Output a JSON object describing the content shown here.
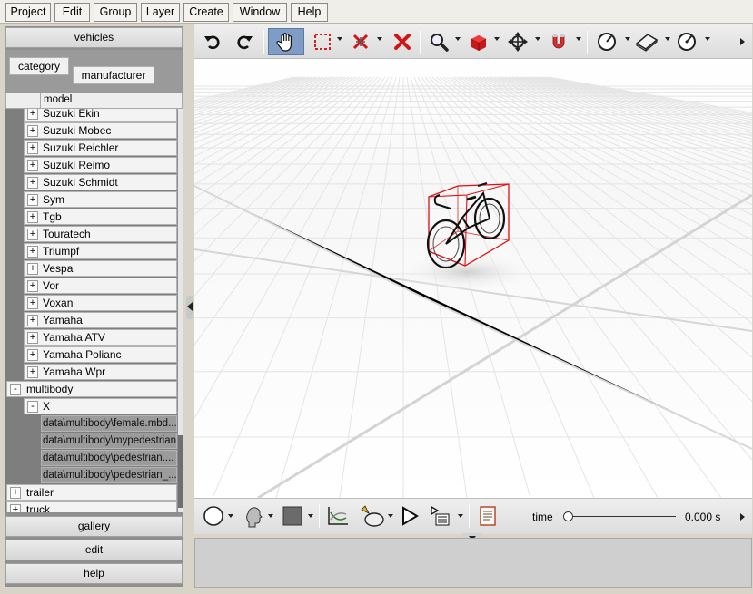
{
  "menu": [
    "Project",
    "Edit",
    "Group",
    "Layer",
    "Create",
    "Window",
    "Help"
  ],
  "sidebar": {
    "header": "vehicles",
    "tabs": [
      "category",
      "manufacturer"
    ],
    "column_header": "model",
    "tree": [
      {
        "label": "Suzuki Ekin",
        "toggle": "+",
        "level": 1
      },
      {
        "label": "Suzuki Mobec",
        "toggle": "+",
        "level": 1
      },
      {
        "label": "Suzuki Reichler",
        "toggle": "+",
        "level": 1
      },
      {
        "label": "Suzuki Reimo",
        "toggle": "+",
        "level": 1
      },
      {
        "label": "Suzuki Schmidt",
        "toggle": "+",
        "level": 1
      },
      {
        "label": "Sym",
        "toggle": "+",
        "level": 1
      },
      {
        "label": "Tgb",
        "toggle": "+",
        "level": 1
      },
      {
        "label": "Touratech",
        "toggle": "+",
        "level": 1
      },
      {
        "label": "Triumpf",
        "toggle": "+",
        "level": 1
      },
      {
        "label": "Vespa",
        "toggle": "+",
        "level": 1
      },
      {
        "label": "Vor",
        "toggle": "+",
        "level": 1
      },
      {
        "label": "Voxan",
        "toggle": "+",
        "level": 1
      },
      {
        "label": "Yamaha",
        "toggle": "+",
        "level": 1
      },
      {
        "label": "Yamaha ATV",
        "toggle": "+",
        "level": 1
      },
      {
        "label": "Yamaha Polianc",
        "toggle": "+",
        "level": 1
      },
      {
        "label": "Yamaha Wpr",
        "toggle": "+",
        "level": 1
      },
      {
        "label": "multibody",
        "toggle": "-",
        "level": 0
      },
      {
        "label": "X",
        "toggle": "-",
        "level": 1
      },
      {
        "label": "data\\multibody\\female.mbd...",
        "toggle": "",
        "level": 2
      },
      {
        "label": "data\\multibody\\mypedestrian...",
        "toggle": "",
        "level": 2
      },
      {
        "label": "data\\multibody\\pedestrian....",
        "toggle": "",
        "level": 2,
        "selected": true
      },
      {
        "label": "data\\multibody\\pedestrian_...",
        "toggle": "",
        "level": 2
      },
      {
        "label": "trailer",
        "toggle": "+",
        "level": 0
      },
      {
        "label": "truck",
        "toggle": "+",
        "level": 0
      }
    ],
    "buttons": [
      "gallery",
      "edit",
      "help"
    ]
  },
  "toolbar_top": {
    "icons": [
      "undo-icon",
      "redo-icon",
      "hand-pan-icon",
      "select-rectangle-icon",
      "delete-vertices-icon",
      "delete-icon",
      "zoom-icon",
      "cube-icon",
      "move-icon",
      "magnet-icon",
      "orbit-icon",
      "plane-icon",
      "measure-icon"
    ]
  },
  "toolbar_bottom": {
    "icons": [
      "circle-icon",
      "head-icon",
      "square-color-icon",
      "graph-icon",
      "animate-icon",
      "play-icon",
      "playlist-icon",
      "report-icon"
    ],
    "time_label": "time",
    "time_value": "0.000 s",
    "time_progress": 0
  },
  "colors": {
    "selection": "#7f9cc4",
    "bbox": "#e01010"
  }
}
